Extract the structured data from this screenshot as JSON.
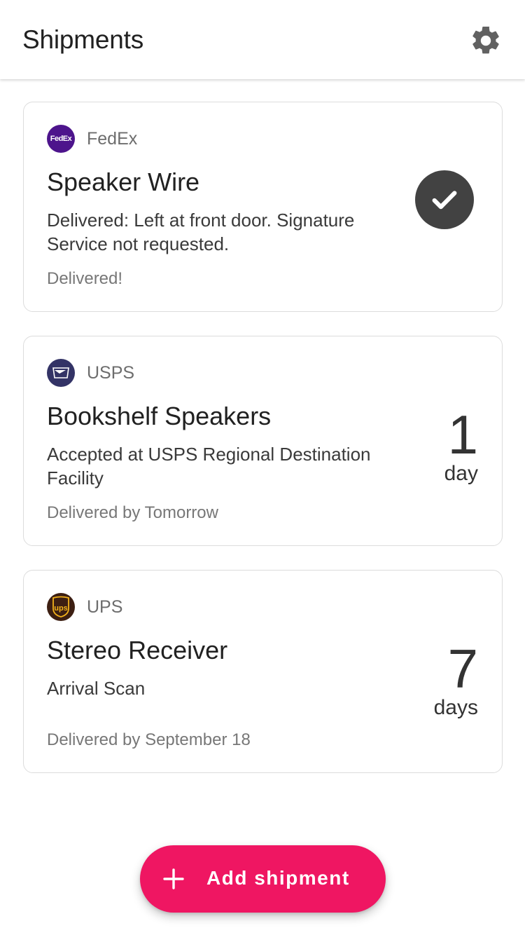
{
  "app_bar": {
    "title": "Shipments",
    "settings_icon": "gear-icon"
  },
  "shipments": [
    {
      "carrier": "FedEx",
      "carrier_logo_text": "FedEx",
      "carrier_color": "#4d148c",
      "title": "Speaker Wire",
      "status": "Delivered: Left at front door. Signature Service not requested.",
      "eta": "Delivered!",
      "indicator": "check-icon"
    },
    {
      "carrier": "USPS",
      "carrier_color": "#333366",
      "title": "Bookshelf Speakers",
      "status": "Accepted at USPS Regional Destination Facility",
      "eta": "Delivered by Tomorrow",
      "days_count": "1",
      "days_unit": "day"
    },
    {
      "carrier": "UPS",
      "carrier_logo_text": "ups",
      "carrier_color": "#3d1f12",
      "title": "Stereo Receiver",
      "status": "Arrival Scan",
      "eta": "Delivered by September 18",
      "days_count": "7",
      "days_unit": "days"
    }
  ],
  "fab": {
    "label": "Add shipment",
    "icon": "plus-icon",
    "color": "#ef1662"
  }
}
